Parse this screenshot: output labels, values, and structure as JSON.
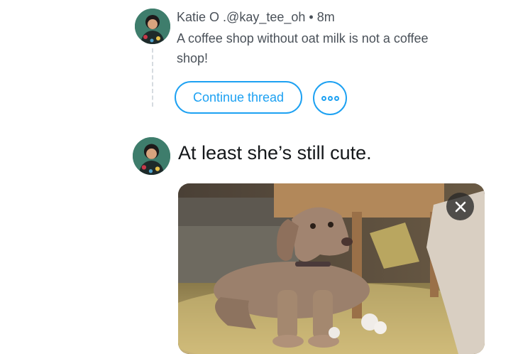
{
  "thread_tweet": {
    "author_name": "Katie O",
    "handle": ".@kay_tee_oh",
    "separator": "•",
    "time": "8m",
    "text": "A coffee shop without oat milk is not a coffee shop!"
  },
  "actions": {
    "continue_thread_label": "Continue thread",
    "more_icon": "more-dots-icon"
  },
  "compose": {
    "text": "At least she’s still cute."
  },
  "media": {
    "description_icon": "attached-photo",
    "remove_icon": "close-icon"
  },
  "colors": {
    "accent": "#1da1f2",
    "secondary_text": "#4a5159",
    "primary_text": "#14171a"
  }
}
